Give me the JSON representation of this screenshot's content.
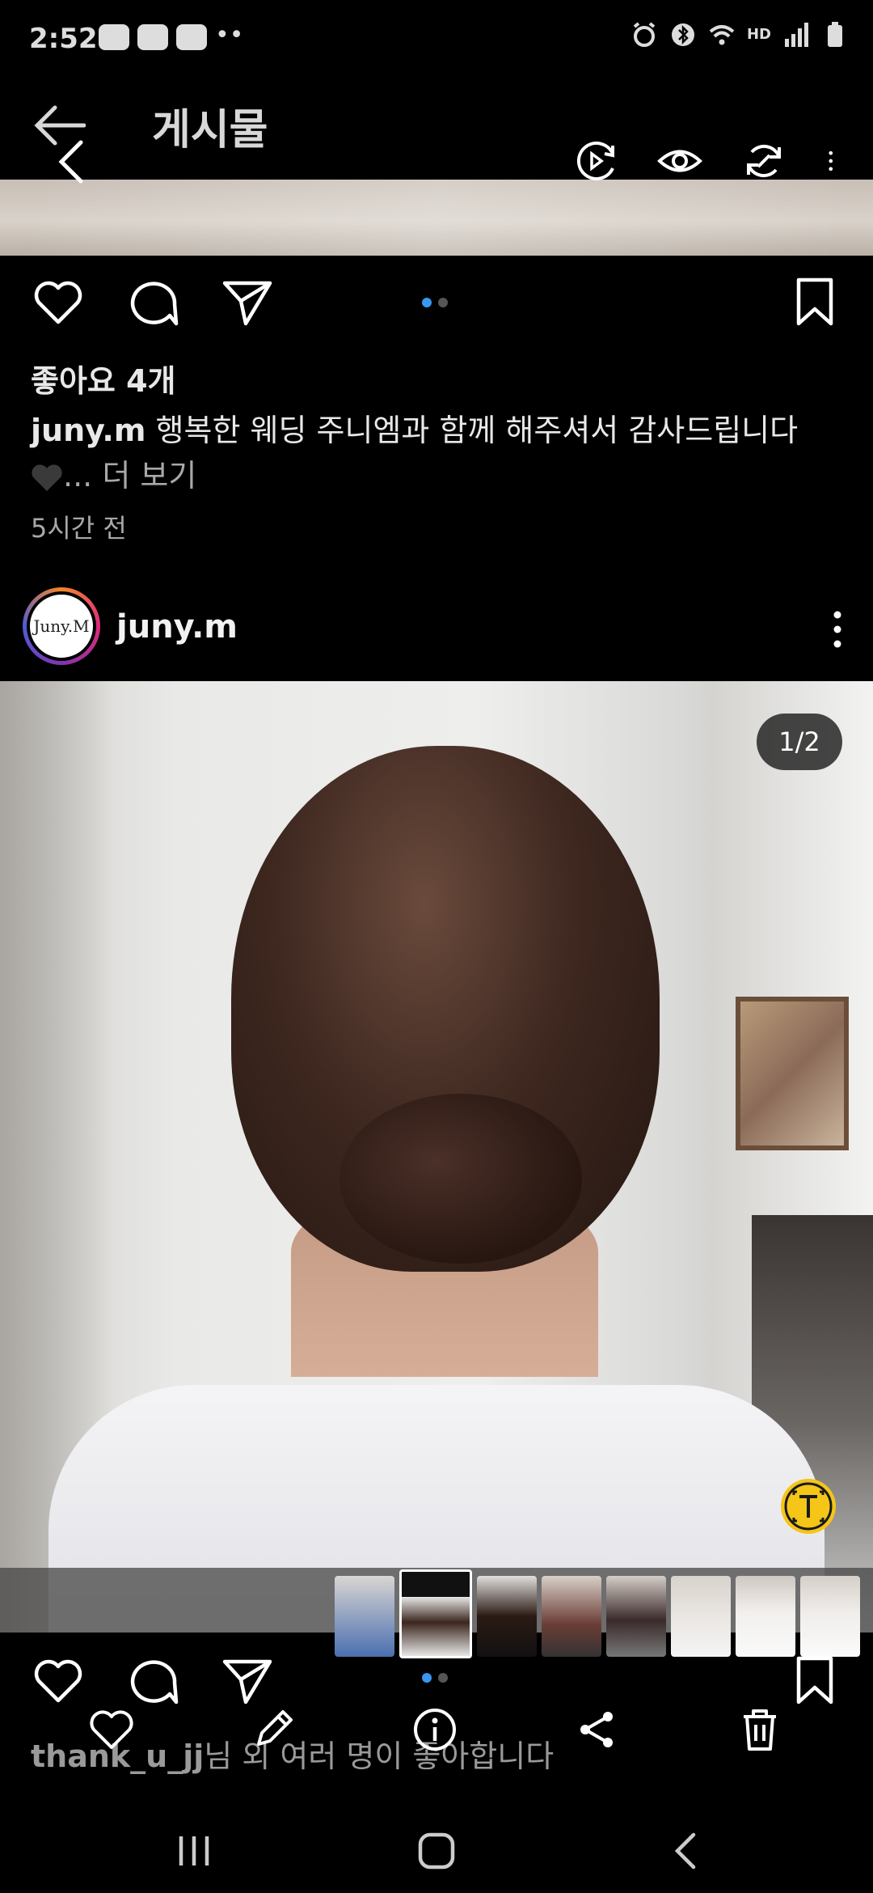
{
  "status_bar": {
    "time": "2:52",
    "right_icons": [
      "alarm-icon",
      "bluetooth-icon",
      "wifi-icon",
      "hd-voice-icon",
      "signal-icon",
      "battery-icon"
    ],
    "hd_label": "HD"
  },
  "header": {
    "title": "게시물"
  },
  "previous_post": {
    "likes": "좋아요 4개",
    "caption_user": "juny.m",
    "caption_text": " 행복한 웨딩 주니엠과 함께 해주셔서 감사드립니다",
    "caption_more": "... 더 보기",
    "timestamp": "5시간 전"
  },
  "post": {
    "username": "juny.m",
    "avatar_text": "Juny.M",
    "page_counter": "1/2"
  },
  "bottom": {
    "likes_by_user": "thank_u_jj",
    "likes_by_text": "님 외 여러 명이 좋아합니다"
  },
  "colors": {
    "background": "#000000",
    "accent": "#3897f0",
    "text": "#e8e8e8",
    "muted": "#a8a8a8",
    "text_detect": "#f5c518"
  }
}
